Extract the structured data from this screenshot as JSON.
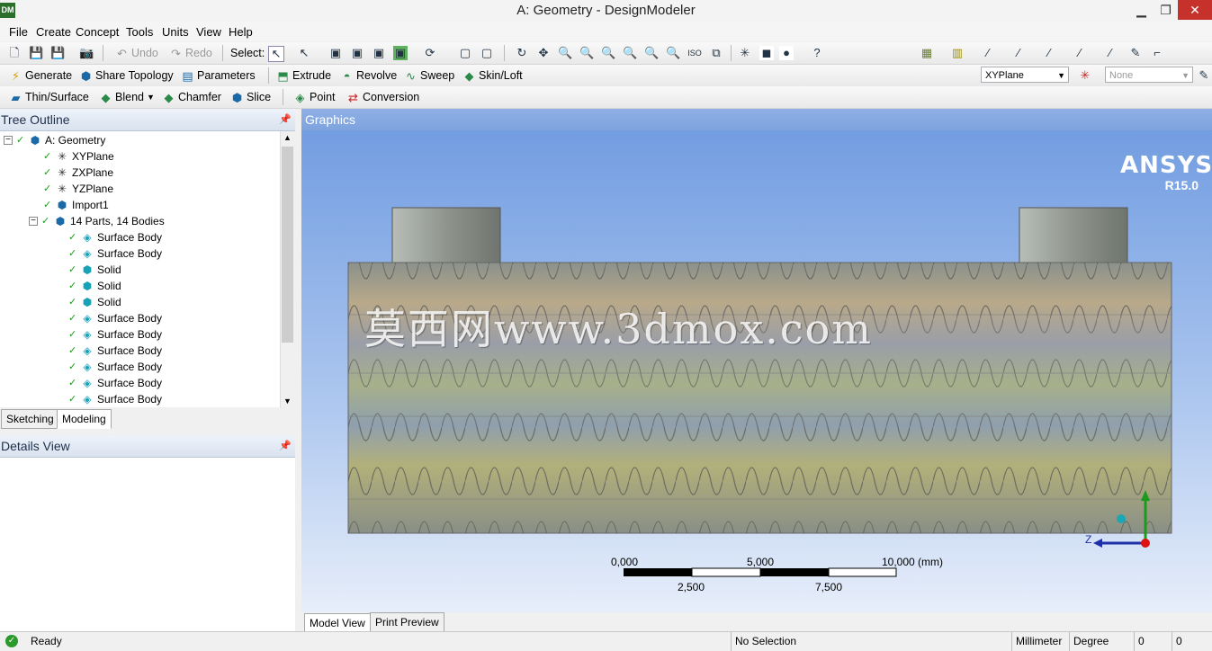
{
  "window": {
    "title": "A: Geometry - DesignModeler",
    "app_icon_text": "DM",
    "controls": [
      "minimize",
      "restore",
      "close"
    ]
  },
  "menu": [
    "File",
    "Create",
    "Concept",
    "Tools",
    "Units",
    "View",
    "Help"
  ],
  "toolbar1": {
    "undo": "Undo",
    "redo": "Redo",
    "select": "Select:"
  },
  "toolbar2": {
    "generate": "Generate",
    "share_topology": "Share Topology",
    "parameters": "Parameters",
    "extrude": "Extrude",
    "revolve": "Revolve",
    "sweep": "Sweep",
    "skin_loft": "Skin/Loft",
    "plane_combo": "XYPlane",
    "sketch_combo": "None"
  },
  "toolbar3": {
    "thin_surface": "Thin/Surface",
    "blend": "Blend",
    "chamfer": "Chamfer",
    "slice": "Slice",
    "point": "Point",
    "conversion": "Conversion"
  },
  "tree_outline": {
    "title": "Tree Outline",
    "items": [
      {
        "label": "A: Geometry",
        "icon": "geometry-icon",
        "level": 0
      },
      {
        "label": "XYPlane",
        "icon": "plane-icon",
        "level": 1
      },
      {
        "label": "ZXPlane",
        "icon": "plane-icon",
        "level": 1
      },
      {
        "label": "YZPlane",
        "icon": "plane-icon",
        "level": 1
      },
      {
        "label": "Import1",
        "icon": "import-icon",
        "level": 1
      },
      {
        "label": "14 Parts, 14 Bodies",
        "icon": "parts-icon",
        "level": 1
      },
      {
        "label": "Surface Body",
        "icon": "surface-body-icon",
        "level": 2
      },
      {
        "label": "Surface Body",
        "icon": "surface-body-icon",
        "level": 2
      },
      {
        "label": "Solid",
        "icon": "solid-body-icon",
        "level": 2
      },
      {
        "label": "Solid",
        "icon": "solid-body-icon",
        "level": 2
      },
      {
        "label": "Solid",
        "icon": "solid-body-icon",
        "level": 2
      },
      {
        "label": "Surface Body",
        "icon": "surface-body-icon",
        "level": 2
      },
      {
        "label": "Surface Body",
        "icon": "surface-body-icon",
        "level": 2
      },
      {
        "label": "Surface Body",
        "icon": "surface-body-icon",
        "level": 2
      },
      {
        "label": "Surface Body",
        "icon": "surface-body-icon",
        "level": 2
      },
      {
        "label": "Surface Body",
        "icon": "surface-body-icon",
        "level": 2
      },
      {
        "label": "Surface Body",
        "icon": "surface-body-icon",
        "level": 2
      }
    ],
    "tabs": [
      "Sketching",
      "Modeling"
    ],
    "active_tab": "Modeling"
  },
  "details_view": {
    "title": "Details View"
  },
  "graphics": {
    "title": "Graphics",
    "brand": "ANSYS",
    "version": "R15.0",
    "watermark": "莫西网www.3dmox.com",
    "scale": {
      "top_labels": [
        "0,000",
        "5,000",
        "10,000 (mm)"
      ],
      "bottom_labels": [
        "2,500",
        "7,500"
      ]
    },
    "triad_axis_label": "Z",
    "tabs": [
      "Model View",
      "Print Preview"
    ],
    "active_tab": "Model View"
  },
  "status_bar": {
    "message": "Ready",
    "selection": "No Selection",
    "length_unit": "Millimeter",
    "angle_unit": "Degree",
    "value_1": "0",
    "value_2": "0"
  },
  "colors": {
    "graphics_top": "#6e9ae0",
    "graphics_bottom": "#e7eefa",
    "check_green": "#1c9a1c",
    "close_red": "#c7312b"
  }
}
